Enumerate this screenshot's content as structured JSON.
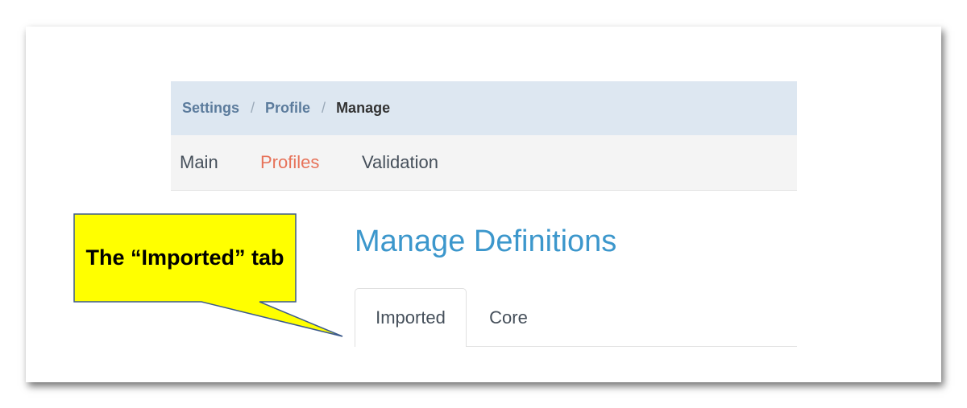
{
  "breadcrumb": {
    "items": [
      "Settings",
      "Profile"
    ],
    "separator": "/",
    "current": "Manage"
  },
  "nav": {
    "items": [
      {
        "label": "Main"
      },
      {
        "label": "Profiles",
        "active": true
      },
      {
        "label": "Validation"
      }
    ]
  },
  "page": {
    "heading": "Manage Definitions"
  },
  "tabs": [
    {
      "label": "Imported",
      "active": true
    },
    {
      "label": "Core"
    }
  ],
  "callout": {
    "text": "The “Imported” tab",
    "fill": "#ffff00",
    "border": "#3c5a8c"
  },
  "colors": {
    "breadcrumb_bg": "#dde7f1",
    "nav_active": "#e7735a",
    "heading": "#3c97cc"
  }
}
